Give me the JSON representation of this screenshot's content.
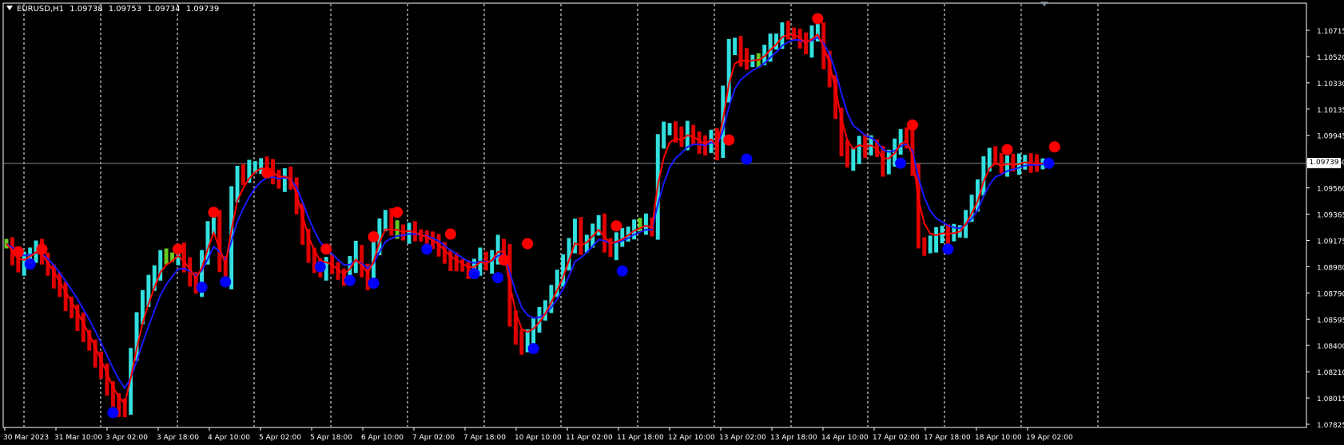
{
  "header": {
    "symbol": "EURUSD,H1",
    "open": "1.09738",
    "high": "1.09753",
    "low": "1.09734",
    "close": "1.09739"
  },
  "current_price_label": "1.09739",
  "colors": {
    "background": "#000000",
    "axis": "#ffffff",
    "grid": "#ffffff",
    "bull_bar": "#33e0e0",
    "bear_bar": "#e00000",
    "neutral_bar": "#66cc22",
    "ma_fast": "#ff0000",
    "ma_slow": "#1a1aff",
    "dot_high": "#ff0000",
    "dot_low": "#0000ff",
    "price_line": "#7f8c99"
  },
  "chart_data": {
    "type": "ohlc",
    "y_ticks": [
      "1.10715",
      "1.10520",
      "1.10330",
      "1.10135",
      "1.09945",
      "1.09750",
      "1.09560",
      "1.09365",
      "1.09175",
      "1.08980",
      "1.08790",
      "1.08595",
      "1.08400",
      "1.08210",
      "1.08015",
      "1.07825"
    ],
    "ylim": [
      1.07825,
      1.10715
    ],
    "x_ticks": [
      "30 Mar 2023",
      "31 Mar 10:00",
      "3 Apr 02:00",
      "3 Apr 18:00",
      "4 Apr 10:00",
      "5 Apr 02:00",
      "5 Apr 18:00",
      "6 Apr 10:00",
      "7 Apr 02:00",
      "7 Apr 18:00",
      "10 Apr 10:00",
      "11 Apr 02:00",
      "11 Apr 18:00",
      "12 Apr 10:00",
      "13 Apr 02:00",
      "13 Apr 18:00",
      "14 Apr 10:00",
      "17 Apr 02:00",
      "17 Apr 18:00",
      "18 Apr 10:00",
      "19 Apr 02:00"
    ],
    "current_price": 1.09739,
    "grid": "vertical dashed",
    "close_series": [
      1.0915,
      1.0905,
      1.0898,
      1.0902,
      1.0908,
      1.0912,
      1.0905,
      1.0895,
      1.0888,
      1.088,
      1.0872,
      1.0865,
      1.0858,
      1.0848,
      1.084,
      1.083,
      1.082,
      1.081,
      1.08,
      1.0795,
      1.0793,
      1.0835,
      1.086,
      1.0875,
      1.0885,
      1.0895,
      1.0905,
      1.0905,
      1.0905,
      1.091,
      1.0898,
      1.089,
      1.0883,
      1.0905,
      1.0925,
      1.0935,
      1.09,
      1.0888,
      1.095,
      1.0968,
      1.0965,
      1.097,
      1.0972,
      1.0973,
      1.097,
      1.0965,
      1.096,
      1.0965,
      1.096,
      1.094,
      1.092,
      1.0905,
      1.09,
      1.0895,
      1.09,
      1.0898,
      1.0892,
      1.089,
      1.09,
      1.091,
      1.0895,
      1.0888,
      1.091,
      1.093,
      1.0935,
      1.0925,
      1.0925,
      1.0922,
      1.0925,
      1.0922,
      1.092,
      1.0918,
      1.0915,
      1.0912,
      1.0905,
      1.0902,
      1.09,
      1.0898,
      1.0895,
      1.0898,
      1.0905,
      1.09,
      1.0905,
      1.0915,
      1.091,
      1.086,
      1.0845,
      1.084,
      1.0848,
      1.0855,
      1.0862,
      1.087,
      1.088,
      1.089,
      1.09,
      1.0915,
      1.0928,
      1.0912,
      1.0918,
      1.0925,
      1.093,
      1.0915,
      1.091,
      1.0918,
      1.092,
      1.0924,
      1.0928,
      1.0928,
      1.093,
      1.0925,
      1.099,
      1.0998,
      1.1,
      1.0995,
      1.099,
      1.0998,
      1.0992,
      1.0988,
      1.0985,
      1.0995,
      1.0982,
      1.1025,
      1.1058,
      1.1062,
      1.1052,
      1.1048,
      1.105,
      1.105,
      1.1055,
      1.1062,
      1.1065,
      1.1072,
      1.107,
      1.1068,
      1.1064,
      1.1058,
      1.1068,
      1.1072,
      1.105,
      1.1035,
      1.101,
      1.0985,
      1.0975,
      1.0978,
      1.099,
      1.0985,
      1.0988,
      1.0982,
      1.097,
      1.0978,
      1.0985,
      1.0995,
      1.0992,
      1.097,
      1.0915,
      1.0912,
      1.0915,
      1.092,
      1.0924,
      1.0922,
      1.0923,
      1.0925,
      1.0935,
      1.0945,
      1.0955,
      1.0975,
      1.098,
      1.0978,
      1.097,
      1.0975,
      1.0972,
      1.0974,
      1.0976,
      1.0974,
      1.0973,
      1.0974
    ],
    "signal_highs": [
      {
        "i": 2,
        "price": 1.0909
      },
      {
        "i": 6,
        "price": 1.0911
      },
      {
        "i": 29,
        "price": 1.0911
      },
      {
        "i": 35,
        "price": 1.0938
      },
      {
        "i": 44,
        "price": 1.0967
      },
      {
        "i": 54,
        "price": 1.0911
      },
      {
        "i": 62,
        "price": 1.092
      },
      {
        "i": 66,
        "price": 1.0938
      },
      {
        "i": 75,
        "price": 1.0922
      },
      {
        "i": 84,
        "price": 1.0903
      },
      {
        "i": 88,
        "price": 1.0915
      },
      {
        "i": 103,
        "price": 1.0928
      },
      {
        "i": 122,
        "price": 1.0991
      },
      {
        "i": 137,
        "price": 1.108
      },
      {
        "i": 153,
        "price": 1.1002
      },
      {
        "i": 169,
        "price": 1.0984
      },
      {
        "i": 177,
        "price": 1.0986
      }
    ],
    "signal_lows": [
      {
        "i": 4,
        "price": 1.09
      },
      {
        "i": 33,
        "price": 1.0883
      },
      {
        "i": 37,
        "price": 1.0887
      },
      {
        "i": 53,
        "price": 1.0898
      },
      {
        "i": 58,
        "price": 1.0888
      },
      {
        "i": 62,
        "price": 1.0886
      },
      {
        "i": 71,
        "price": 1.0911
      },
      {
        "i": 79,
        "price": 1.0893
      },
      {
        "i": 83,
        "price": 1.089
      },
      {
        "i": 89,
        "price": 1.0838
      },
      {
        "i": 104,
        "price": 1.0895
      },
      {
        "i": 125,
        "price": 1.0977
      },
      {
        "i": 151,
        "price": 1.0974
      },
      {
        "i": 159,
        "price": 1.0911
      },
      {
        "i": 176,
        "price": 1.0974
      },
      {
        "i": 18,
        "price": 1.0791
      }
    ]
  }
}
